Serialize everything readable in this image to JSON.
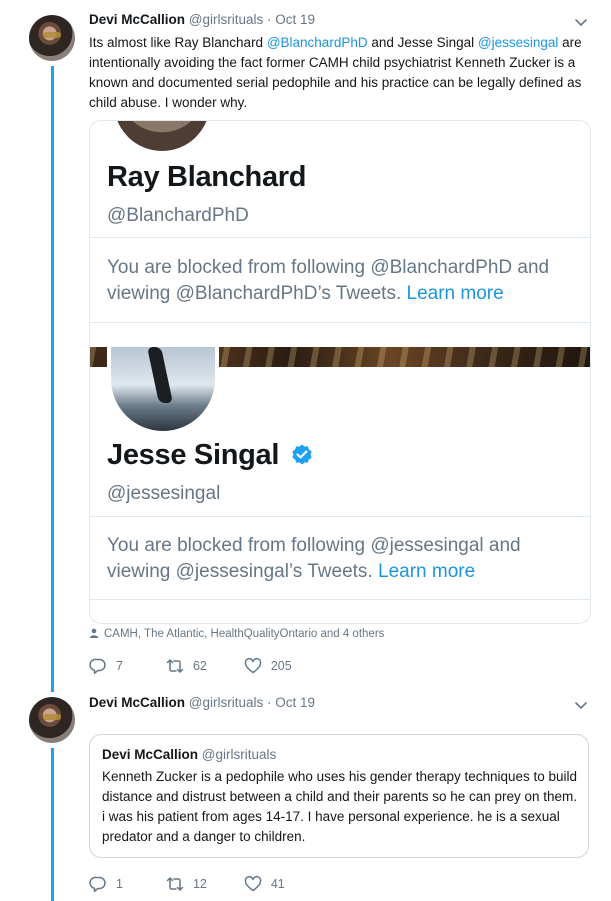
{
  "tweet1": {
    "name": "Devi McCallion",
    "handle": "@girlsrituals",
    "separator": "·",
    "date": "Oct 19",
    "text_1": "Its almost like Ray Blanchard ",
    "mention_1": "@BlanchardPhD",
    "text_2": " and Jesse Singal ",
    "mention_2": "@jessesingal",
    "text_3": " are intentionally avoiding the fact former CAMH child psychiatrist Kenneth Zucker is a known and documented serial pedophile and his practice can be legally defined as child abuse. I wonder why.",
    "card": {
      "profile1_name": "Ray Blanchard",
      "profile1_handle": "@BlanchardPhD",
      "profile1_blocked": "You are blocked from following @BlanchardPhD and viewing @BlanchardPhD’s Tweets.",
      "profile2_name": "Jesse Singal",
      "profile2_handle": "@jessesingal",
      "profile2_blocked": "You are blocked from following @jessesingal and viewing @jessesingal’s Tweets.",
      "learn_more": "Learn more"
    },
    "context": "CAMH, The Atlantic, HealthQualityOntario and 4 others",
    "replies": "7",
    "retweets": "62",
    "likes": "205"
  },
  "tweet2": {
    "name": "Devi McCallion",
    "handle": "@girlsrituals",
    "separator": "·",
    "date": "Oct 19",
    "quote": {
      "name": "Devi McCallion",
      "handle": "@girlsrituals",
      "text": "Kenneth Zucker is a pedophile who uses his gender therapy techniques to build distance and distrust between a child and their parents so he can prey on them. i was his patient from ages 14-17. I have personal experience. he is a sexual predator and a danger to children."
    },
    "replies": "1",
    "retweets": "12",
    "likes": "41"
  },
  "colors": {
    "accent": "#1da1f2",
    "link": "#1b95e0",
    "muted": "#657786",
    "border": "#e1e8ed"
  },
  "icons": [
    "chevron-down-icon",
    "reply-icon",
    "retweet-icon",
    "like-icon",
    "person-icon",
    "verified-badge-icon"
  ]
}
